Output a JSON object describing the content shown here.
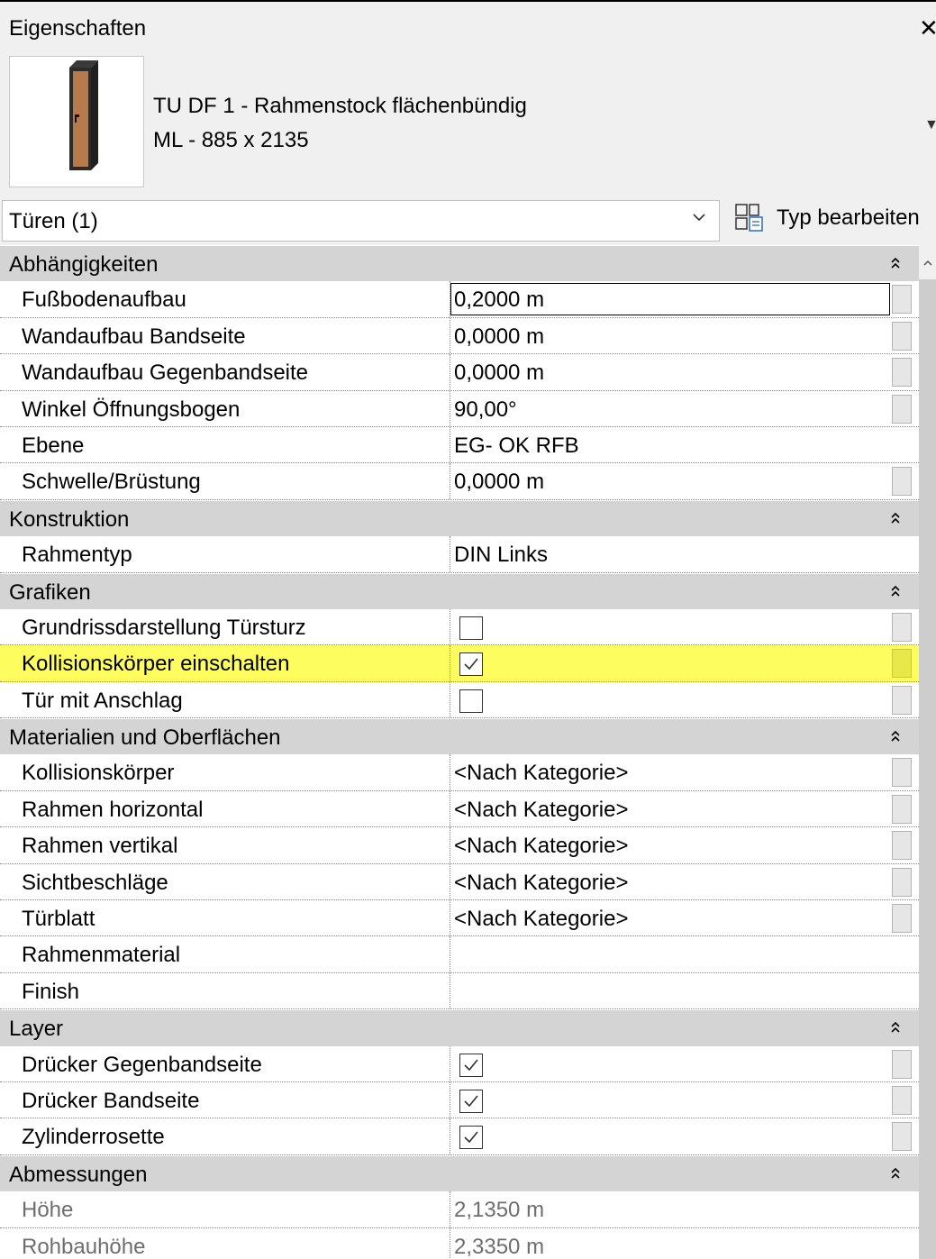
{
  "window": {
    "title": "Eigenschaften",
    "close_glyph": "✕"
  },
  "type_selector": {
    "name": "TU DF 1 - Rahmenstock flächenbündig",
    "size": "ML - 885 x 2135",
    "dropdown_glyph": "▼"
  },
  "category": {
    "label": "Türen (1)",
    "edit_type_label": "Typ bearbeiten"
  },
  "colors": {
    "highlight": "#fdfd60",
    "group_header": "#d4d4d4"
  },
  "icons": {
    "preview": "door-preview-icon",
    "edit_type": "edit-type-icon",
    "collapse": "double-chevron-up-icon"
  },
  "groups": [
    {
      "label": "Abhängigkeiten",
      "rows": [
        {
          "label": "Fußbodenaufbau",
          "value": "0,2000 m",
          "editing": true,
          "button": true
        },
        {
          "label": "Wandaufbau Bandseite",
          "value": "0,0000 m",
          "button": true
        },
        {
          "label": "Wandaufbau Gegenbandseite",
          "value": "0,0000 m",
          "button": true
        },
        {
          "label": "Winkel Öffnungsbogen",
          "value": "90,00°",
          "button": true
        },
        {
          "label": "Ebene",
          "value": "EG- OK RFB",
          "button": false
        },
        {
          "label": "Schwelle/Brüstung",
          "value": "0,0000 m",
          "button": true
        }
      ]
    },
    {
      "label": "Konstruktion",
      "rows": [
        {
          "label": "Rahmentyp",
          "value": "DIN Links",
          "button": false
        }
      ]
    },
    {
      "label": "Grafiken",
      "rows": [
        {
          "label": "Grundrissdarstellung Türsturz",
          "checkbox": true,
          "checked": false,
          "button": true
        },
        {
          "label": "Kollisionskörper einschalten",
          "checkbox": true,
          "checked": true,
          "highlighted": true,
          "button": true
        },
        {
          "label": "Tür mit Anschlag",
          "checkbox": true,
          "checked": false,
          "button": true
        }
      ]
    },
    {
      "label": "Materialien und Oberflächen",
      "rows": [
        {
          "label": "Kollisionskörper",
          "value": "<Nach Kategorie>",
          "button": true
        },
        {
          "label": "Rahmen horizontal",
          "value": "<Nach Kategorie>",
          "button": true
        },
        {
          "label": "Rahmen vertikal",
          "value": "<Nach Kategorie>",
          "button": true
        },
        {
          "label": "Sichtbeschläge",
          "value": "<Nach Kategorie>",
          "button": true
        },
        {
          "label": "Türblatt",
          "value": "<Nach Kategorie>",
          "button": true
        },
        {
          "label": "Rahmenmaterial",
          "value": "",
          "button": false
        },
        {
          "label": "Finish",
          "value": "",
          "button": false
        }
      ]
    },
    {
      "label": "Layer",
      "rows": [
        {
          "label": "Drücker Gegenbandseite",
          "checkbox": true,
          "checked": true,
          "button": true
        },
        {
          "label": "Drücker Bandseite",
          "checkbox": true,
          "checked": true,
          "button": true
        },
        {
          "label": "Zylinderrosette",
          "checkbox": true,
          "checked": true,
          "button": true
        }
      ]
    },
    {
      "label": "Abmessungen",
      "rows": [
        {
          "label": "Höhe",
          "value": "2,1350 m",
          "readonly": true,
          "button": false
        },
        {
          "label": "Rohbauhöhe",
          "value": "2,3350 m",
          "readonly": true,
          "button": false
        }
      ]
    }
  ]
}
